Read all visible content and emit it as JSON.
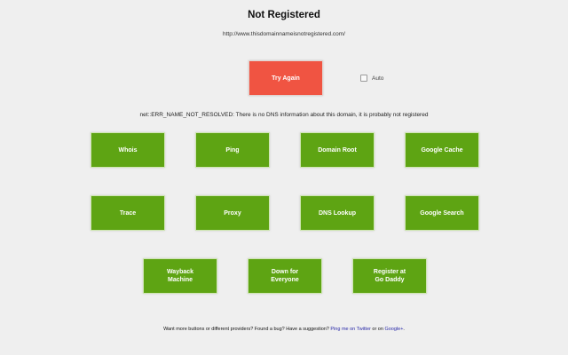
{
  "header": {
    "title": "Not Registered",
    "url": "http://www.thisdomainnameisnotregistered.com/"
  },
  "retry": {
    "try_again_label": "Try Again",
    "auto_label": "Auto",
    "auto_checked": false
  },
  "error": {
    "message": "net::ERR_NAME_NOT_RESOLVED: There is no DNS information about this domain, it is probably not registered"
  },
  "buttons": {
    "row1": [
      "Whois",
      "Ping",
      "Domain Root",
      "Google Cache"
    ],
    "row2": [
      "Trace",
      "Proxy",
      "DNS Lookup",
      "Google Search"
    ],
    "row3": [
      "Wayback\nMachine",
      "Down for\nEveryone",
      "Register at\nGo Daddy"
    ]
  },
  "footer": {
    "text_before": "Want more buttons or different providers? Found a bug? Have a suggestion? ",
    "twitter_link": "Ping me on Twitter",
    "middle": " or on ",
    "gplus_link": "Google+",
    "text_after": "."
  },
  "colors": {
    "background": "#efefef",
    "try_again": "#f05442",
    "action_button": "#5ea413",
    "link": "#2a2aa8"
  }
}
